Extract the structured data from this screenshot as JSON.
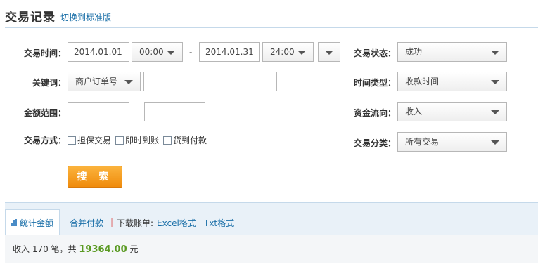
{
  "header": {
    "title": "交易记录",
    "switch_link": "切换到标准版"
  },
  "form": {
    "trade_time": {
      "label": "交易时间：",
      "start_date": "2014.01.01",
      "start_time": "00:00",
      "dash": "-",
      "end_date": "2014.01.31",
      "end_time": "24:00"
    },
    "keyword": {
      "label": "关键词：",
      "type_selected": "商户订单号",
      "value": ""
    },
    "amount_range": {
      "label": "金额范围：",
      "min": "",
      "dash": "-",
      "max": ""
    },
    "trade_method": {
      "label": "交易方式：",
      "options": [
        "担保交易",
        "即时到账",
        "货到付款"
      ]
    },
    "trade_status": {
      "label": "交易状态：",
      "selected": "成功"
    },
    "time_type": {
      "label": "时间类型：",
      "selected": "收款时间"
    },
    "fund_flow": {
      "label": "资金流向：",
      "selected": "收入"
    },
    "trade_category": {
      "label": "交易分类：",
      "selected": "所有交易"
    },
    "search_button": "搜 索"
  },
  "tabs": {
    "stats": "统计金额",
    "merge_pay": "合并付款",
    "separator": "|",
    "download_label": "下载账单:",
    "excel": "Excel格式",
    "txt": "Txt格式"
  },
  "summary": {
    "prefix": "收入 170 笔，共 ",
    "amount": "19364.00",
    "suffix": " 元"
  },
  "colors": {
    "accent": "#1a6fa8",
    "button": "#f39c1a",
    "amount": "#5a9a23"
  }
}
